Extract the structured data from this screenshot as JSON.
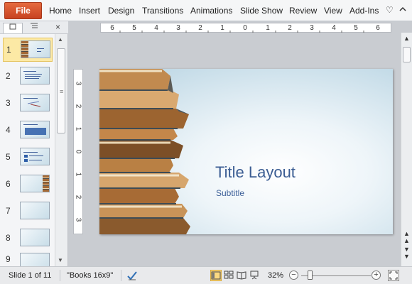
{
  "ribbon": {
    "file_label": "File",
    "tabs": [
      "Home",
      "Insert",
      "Design",
      "Transitions",
      "Animations",
      "Slide Show",
      "Review",
      "View",
      "Add-Ins"
    ],
    "help_icon": "heart-icon",
    "collapse_icon": "chevron-up-icon"
  },
  "panel": {
    "close_glyph": "×",
    "slide_numbers": [
      "1",
      "2",
      "3",
      "4",
      "5",
      "6",
      "7",
      "8",
      "9"
    ],
    "selected_slide": 1
  },
  "ruler": {
    "h_labels": [
      "6",
      "5",
      "4",
      "3",
      "2",
      "1",
      "0",
      "1",
      "2",
      "3",
      "4",
      "5",
      "6"
    ],
    "v_labels": [
      "3",
      "2",
      "1",
      "0",
      "1",
      "2",
      "3"
    ]
  },
  "slide": {
    "title": "Title Layout",
    "subtitle": "Subtitle"
  },
  "status": {
    "slide_info": "Slide 1 of 11",
    "theme": "\"Books 16x9\"",
    "zoom": "32%",
    "zoom_level": 0.32
  },
  "colors": {
    "file_tab": "#d35230",
    "title_text": "#3b5d93",
    "selection": "#fce9a5"
  }
}
